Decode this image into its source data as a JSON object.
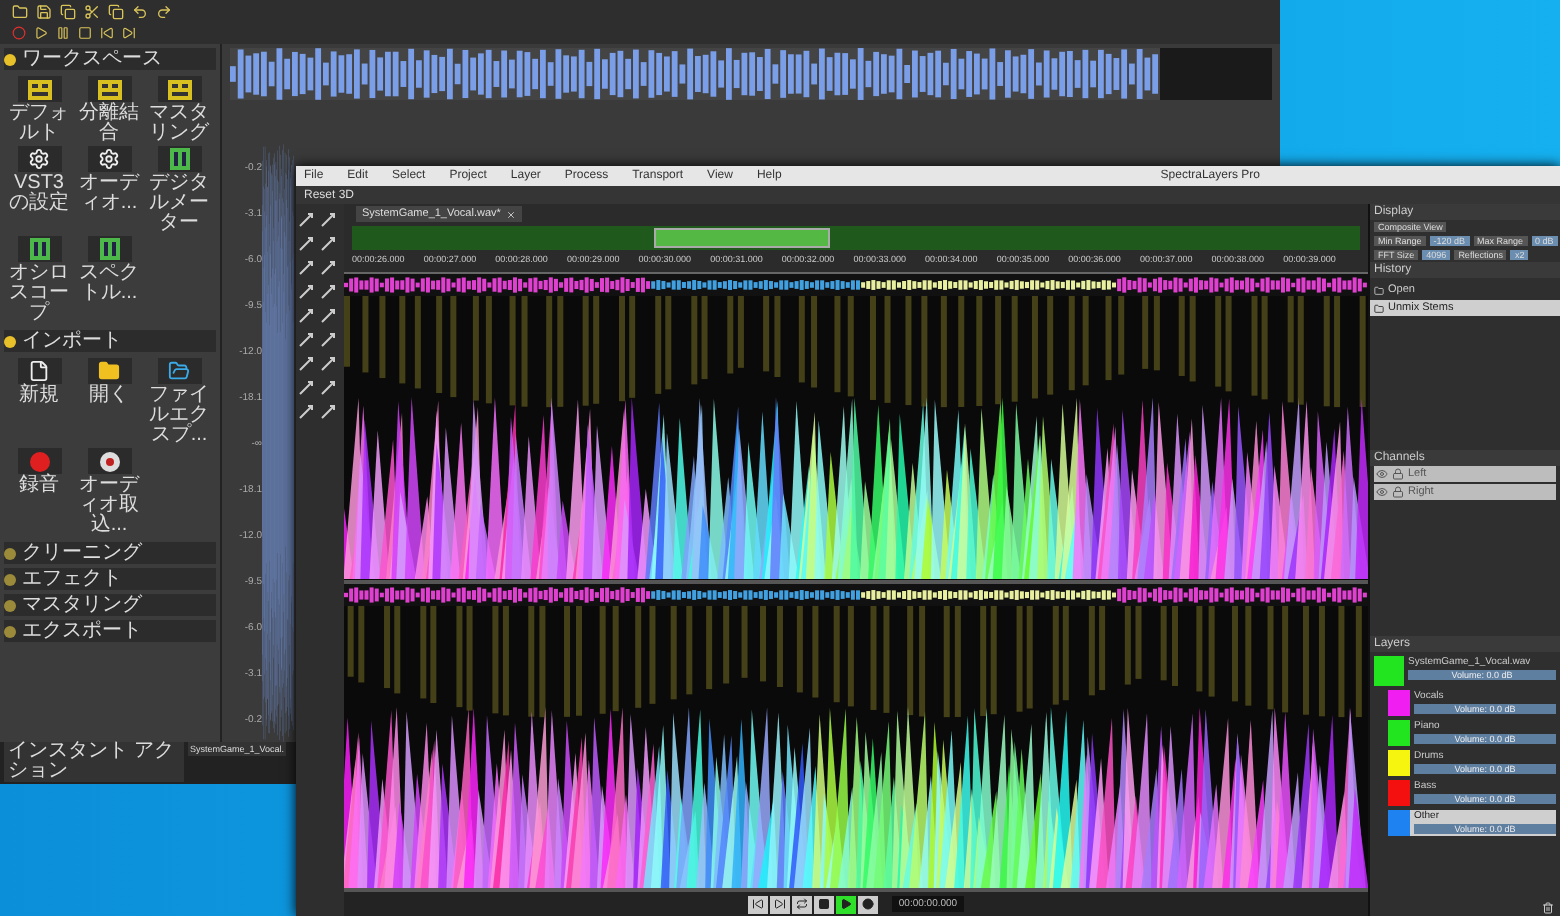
{
  "back_window": {
    "sections": [
      {
        "title": "ワークスペース",
        "expanded": true,
        "items": [
          {
            "kind": "layout",
            "label": "デフォルト"
          },
          {
            "kind": "layout",
            "label": "分離結合"
          },
          {
            "kind": "layout",
            "label": "マスタリング"
          },
          {
            "kind": "gear",
            "label": "VST3の設定"
          },
          {
            "kind": "gear",
            "label": "オーディオ..."
          },
          {
            "kind": "meter",
            "label": "デジタルメーター"
          },
          {
            "kind": "meter",
            "label": "オシロスコープ"
          },
          {
            "kind": "meter",
            "label": "スペクトル..."
          }
        ]
      },
      {
        "title": "インポート",
        "expanded": true,
        "items": [
          {
            "kind": "file",
            "label": "新規"
          },
          {
            "kind": "folder",
            "label": "開く"
          },
          {
            "kind": "explorer",
            "label": "ファイルエクスプ..."
          },
          {
            "kind": "record",
            "label": "録音"
          },
          {
            "kind": "extract",
            "label": "オーディオ取込..."
          }
        ]
      },
      {
        "title": "クリーニング",
        "expanded": false
      },
      {
        "title": "エフェクト",
        "expanded": false
      },
      {
        "title": "マスタリング",
        "expanded": false
      },
      {
        "title": "エクスポート",
        "expanded": false
      }
    ],
    "panel_tab": "インスタント アクション",
    "track_tab": "SystemGame_1_Vocal.",
    "db_scale": [
      "-0.2",
      "-3.1",
      "-6.0",
      "-9.5",
      "-12.0",
      "-18.1",
      "-∞",
      "-18.1",
      "-12.0",
      "-9.5",
      "-6.0",
      "-3.1",
      "-0.2"
    ]
  },
  "front_window": {
    "title": "SpectraLayers Pro",
    "menu": [
      "File",
      "Edit",
      "Select",
      "Project",
      "Layer",
      "Process",
      "Transport",
      "View",
      "Help"
    ],
    "toolbar_button": "Reset 3D",
    "file_tab": "SystemGame_1_Vocal.wav*",
    "ruler": [
      "00:00:26.000",
      "00:00:27.000",
      "00:00:28.000",
      "00:00:29.000",
      "00:00:30.000",
      "00:00:31.000",
      "00:00:32.000",
      "00:00:33.000",
      "00:00:34.000",
      "00:00:35.000",
      "00:00:36.000",
      "00:00:37.000",
      "00:00:38.000",
      "00:00:39.000"
    ],
    "display": {
      "title": "Display",
      "view": "Composite View",
      "fields": [
        {
          "label": "Min Range",
          "value": "-120 dB"
        },
        {
          "label": "Max Range",
          "value": "0 dB"
        },
        {
          "label": "FFT Size",
          "value": "4096"
        },
        {
          "label": "Reflections",
          "value": "x2"
        }
      ]
    },
    "history": {
      "title": "History",
      "items": [
        {
          "label": "Open",
          "selected": false
        },
        {
          "label": "Unmix Stems",
          "selected": true
        }
      ]
    },
    "channels": {
      "title": "Channels",
      "items": [
        "Left",
        "Right"
      ]
    },
    "layers": {
      "title": "Layers",
      "items": [
        {
          "name": "SystemGame_1_Vocal.wav",
          "color": "#22e51f",
          "volume": "Volume: 0.0 dB",
          "selected": false,
          "children": [
            {
              "name": "Vocals",
              "color": "#f01ef0",
              "volume": "Volume: 0.0 dB",
              "selected": false
            },
            {
              "name": "Piano",
              "color": "#22e51f",
              "volume": "Volume: 0.0 dB",
              "selected": false
            },
            {
              "name": "Drums",
              "color": "#f5f50f",
              "volume": "Volume: 0.0 dB",
              "selected": false
            },
            {
              "name": "Bass",
              "color": "#f51010",
              "volume": "Volume: 0.0 dB",
              "selected": false
            },
            {
              "name": "Other",
              "color": "#1e82f0",
              "volume": "Volume: 0.0 dB",
              "selected": true
            }
          ]
        }
      ]
    },
    "transport": {
      "buttons": [
        {
          "kind": "start",
          "selected": false
        },
        {
          "kind": "end",
          "selected": false
        },
        {
          "kind": "loop",
          "selected": false
        },
        {
          "kind": "stop",
          "selected": false
        },
        {
          "kind": "play",
          "selected": true
        },
        {
          "kind": "record",
          "selected": false
        }
      ],
      "time": "00:00:00.000"
    }
  }
}
